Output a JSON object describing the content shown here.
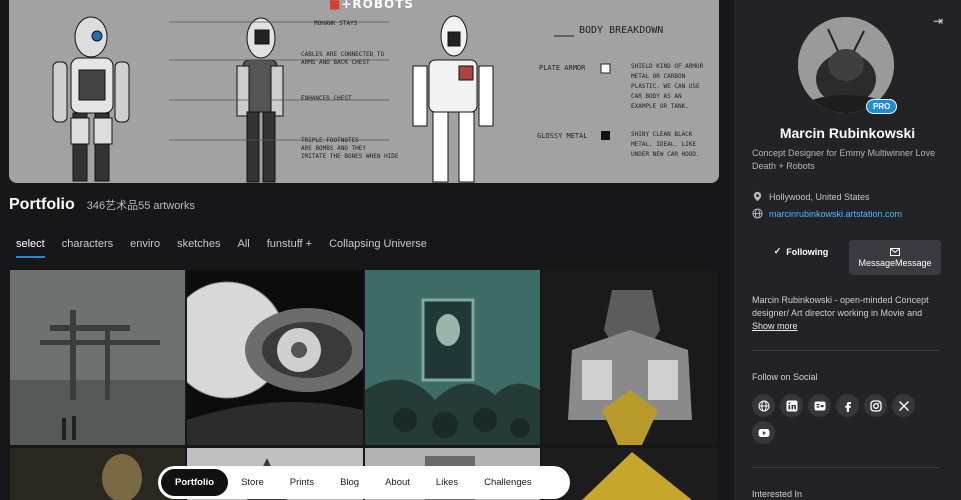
{
  "banner": {
    "title_prefix": "",
    "title_suffix": "+ROBOTS",
    "sketch_notes": [
      "MOHAWK STAYS",
      "CABLES ARE CONNECTED TO ARMS AND BACK CHEST",
      "ENHANCED CHEST",
      "TRIPLE FOOTNOTES ARE BOMBS AND THEY IMITATE THE BONES WHEN HIDE",
      "BODY BREAKDOWN",
      "PLATE ARMOR",
      "SHIELD KIND OF ARMOR METAL OR CARBON PLASTIC. WE CAN USE CAR BODY AS AN EXAMPLE OR TANK.",
      "GLOSSY METAL",
      "SHINY CLEAN BLACK METAL. IDEAL. LIKE UNDER NEW CAR HOOD."
    ]
  },
  "portfolio": {
    "title": "Portfolio",
    "count": "346艺术品55 artworks"
  },
  "tabs": [
    "select",
    "characters",
    "enviro",
    "sketches",
    "All",
    "funstuff +",
    "Collapsing Universe"
  ],
  "bottom_nav": [
    "Portfolio",
    "Store",
    "Prints",
    "Blog",
    "About",
    "Likes",
    "Challenges"
  ],
  "profile": {
    "name": "Marcin Rubinkowski",
    "badge": "PRO",
    "headline": "Concept Designer for Emmy Multiwinner Love Death + Robots",
    "location": "Hollywood, United States",
    "website": "marcinrubinkowski.artstation.com",
    "follow_label": "Following",
    "message_label": "MessageMessage",
    "about": "Marcin Rubinkowski - open-minded Concept designer/ Art director working in Movie and",
    "show_more": "Show more",
    "follow_on_social": "Follow on Social",
    "interested_in": "Interested In"
  },
  "social_icons": [
    "globe-icon",
    "linkedin-icon",
    "behance-icon",
    "facebook-icon",
    "instagram-icon",
    "x-icon",
    "youtube-icon"
  ],
  "colors": {
    "accent": "#1f8dd6",
    "background": "#17171a",
    "sidebar": "#232327"
  }
}
